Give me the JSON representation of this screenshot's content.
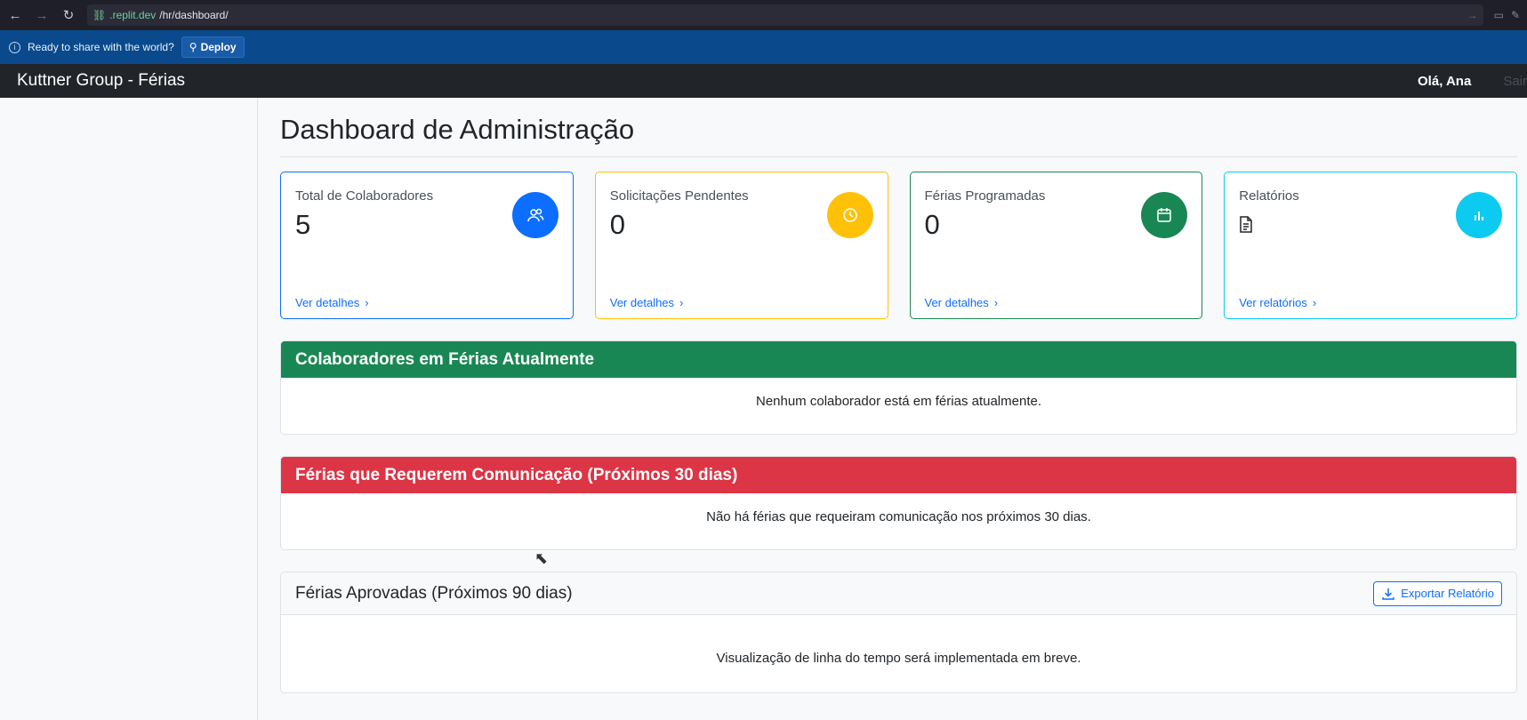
{
  "browser": {
    "url_domain": ".replit.dev",
    "url_path": "/hr/dashboard/"
  },
  "deploy_bar": {
    "message": "Ready to share with the world?",
    "deploy_label": "Deploy"
  },
  "navbar": {
    "brand": "Kuttner Group - Férias",
    "greeting": "Olá, Ana",
    "logout": "Sair"
  },
  "page": {
    "title": "Dashboard de Administração"
  },
  "cards": [
    {
      "label": "Total de Colaboradores",
      "value": "5",
      "link": "Ver detalhes",
      "icon": "users-icon",
      "color": "#0d6efd"
    },
    {
      "label": "Solicitações Pendentes",
      "value": "0",
      "link": "Ver detalhes",
      "icon": "clock-icon",
      "color": "#ffc107"
    },
    {
      "label": "Férias Programadas",
      "value": "0",
      "link": "Ver detalhes",
      "icon": "calendar-icon",
      "color": "#198754"
    },
    {
      "label": "Relatórios",
      "value": "",
      "link": "Ver relatórios",
      "icon": "bar-chart-icon",
      "color": "#0dcaf0"
    }
  ],
  "panels": {
    "on_vacation": {
      "title": "Colaboradores em Férias Atualmente",
      "message": "Nenhum colaborador está em férias atualmente."
    },
    "communication": {
      "title": "Férias que Requerem Comunicação (Próximos 30 dias)",
      "message": "Não há férias que requeiram comunicação nos próximos 30 dias."
    },
    "approved": {
      "title": "Férias Aprovadas (Próximos 90 dias)",
      "export_label": "Exportar Relatório",
      "message": "Visualização de linha do tempo será implementada em breve."
    }
  }
}
